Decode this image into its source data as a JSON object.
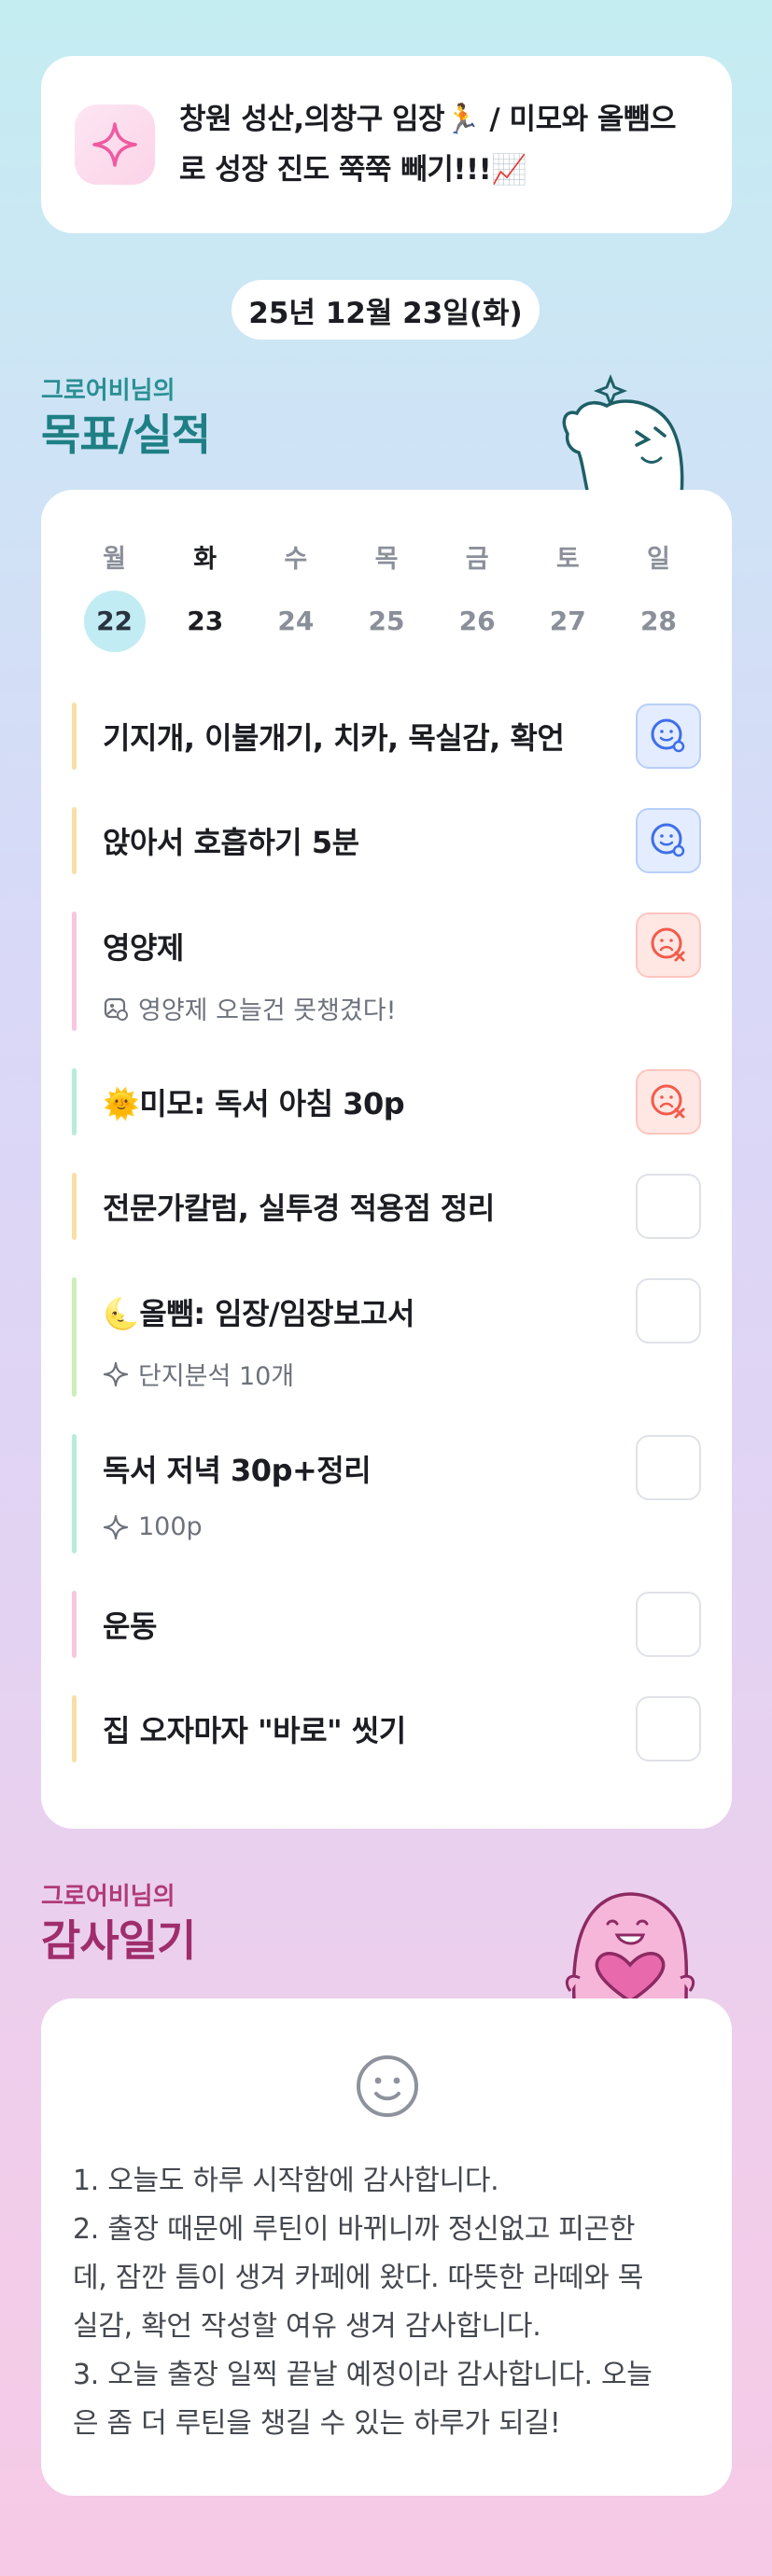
{
  "header": {
    "icon": "sparkle-icon",
    "text_line1": "창원 성산,의창구 임장🏃 / 미모와 올뺌으",
    "text_line2": "로 성장 진도 쭉쭉 빼기!!!📈"
  },
  "date_label": "25년 12월 23일(화)",
  "goals_section": {
    "subtitle": "그로어비님의",
    "title": "목표/실적"
  },
  "week": {
    "days": [
      "월",
      "화",
      "수",
      "목",
      "금",
      "토",
      "일"
    ],
    "dates": [
      "22",
      "23",
      "24",
      "25",
      "26",
      "27",
      "28"
    ],
    "today_index": 1,
    "highlight_index": 0
  },
  "tasks": [
    {
      "name": "기지개, 이불개기, 치카, 목실감, 확언",
      "bar_color": "#f8dfa5",
      "status": "done"
    },
    {
      "name": "앉아서 호흡하기 5분",
      "bar_color": "#f8dfa5",
      "status": "done"
    },
    {
      "name": "영양제",
      "bar_color": "#f9c6df",
      "status": "failed",
      "note": "영양제 오늘건 못챙겼다!",
      "note_icon": "photo-note-icon"
    },
    {
      "name": "🌞미모: 독서 아침 30p",
      "bar_color": "#b8ecd9",
      "status": "failed"
    },
    {
      "name": "전문가칼럼, 실투경 적용점 정리",
      "bar_color": "#f8dfa5",
      "status": "empty"
    },
    {
      "name": "🌜올뺌: 임장/임장보고서",
      "bar_color": "#cdefb8",
      "status": "empty",
      "note": "단지분석 10개",
      "note_icon": "sparkle-outline-icon"
    },
    {
      "name": "독서 저녁 30p+정리",
      "bar_color": "#b8ecd9",
      "status": "empty",
      "note": "100p",
      "note_icon": "sparkle-outline-icon"
    },
    {
      "name": "운동",
      "bar_color": "#f9c6df",
      "status": "empty"
    },
    {
      "name": "집 오자마자 \"바로\" 씻기",
      "bar_color": "#f8dfa5",
      "status": "empty"
    }
  ],
  "thanks_section": {
    "subtitle": "그로어비님의",
    "title": "감사일기"
  },
  "thanks": {
    "mood_icon": "smiley-icon",
    "lines": [
      "1. 오늘도 하루 시작함에 감사합니다.",
      "2. 출장 때문에 루틴이 바뀌니까 정신없고 피곤한",
      "데, 잠깐 틈이 생겨 카페에 왔다. 따뜻한 라떼와 목",
      "실감, 확언 작성할 여유 생겨 감사합니다.",
      "3. 오늘 출장 일찍 끝날 예정이라 감사합니다. 오늘",
      "은 좀 더 루틴을 챙길 수 있는 하루가 되길!"
    ]
  },
  "colors": {
    "good": "#3f6ee8",
    "bad": "#f25b4b",
    "goal_title": "#1e7f84",
    "thanks_title": "#9f2d6c"
  }
}
